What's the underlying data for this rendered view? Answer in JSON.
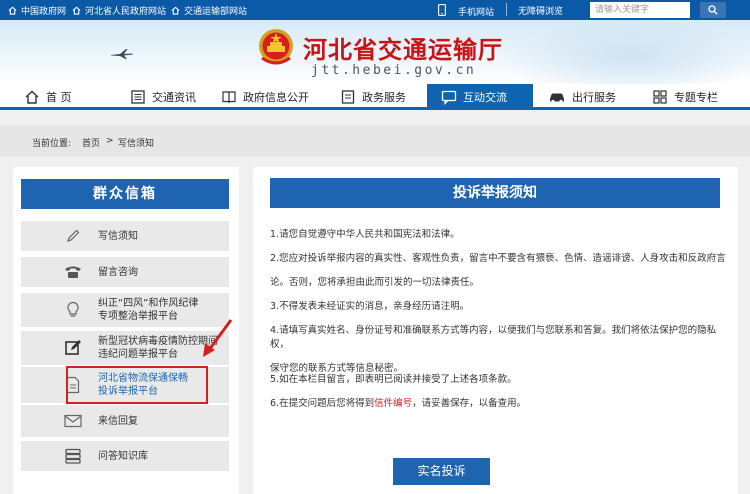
{
  "topbar": {
    "links": [
      "中国政府网",
      "河北省人民政府网站",
      "交通运输部网站"
    ],
    "mobile": "手机网站",
    "accessible": "无障碍浏览",
    "search_placeholder": "请输入关键字"
  },
  "header": {
    "title": "河北省交通运输厅",
    "domain": "jtt.hebei.gov.cn"
  },
  "nav": {
    "items": [
      {
        "label": "首  页",
        "icon": "home-icon"
      },
      {
        "label": "交通资讯",
        "icon": "news-icon"
      },
      {
        "label": "政府信息公开",
        "icon": "book-icon"
      },
      {
        "label": "政务服务",
        "icon": "form-icon"
      },
      {
        "label": "互动交流",
        "icon": "chat-icon"
      },
      {
        "label": "出行服务",
        "icon": "car-icon"
      },
      {
        "label": "专题专栏",
        "icon": "grid-icon"
      }
    ],
    "active_index": 4,
    "accent": "#0e64ae"
  },
  "breadcrumb": {
    "prefix": "当前位置:",
    "home": "首页",
    "separator": ">",
    "current": "写信须知"
  },
  "sidebar": {
    "title": "群众信箱",
    "items": [
      {
        "line1": "写信须知",
        "line2": "",
        "icon": "pen-icon"
      },
      {
        "line1": "留言咨询",
        "line2": "",
        "icon": "phone-icon"
      },
      {
        "line1": "纠正“四风”和作风纪律",
        "line2": "专项整治举报平台",
        "icon": "bulb-icon"
      },
      {
        "line1": "新型冠状病毒疫情防控期间",
        "line2": "违纪问题举报平台",
        "icon": "edit-icon"
      },
      {
        "line1": "河北省物流保通保畅",
        "line2": "投诉举报平台",
        "icon": "document-icon",
        "link_color": "#1e64b0"
      },
      {
        "line1": "来信回复",
        "line2": "",
        "icon": "mail-icon"
      },
      {
        "line1": "问答知识库",
        "line2": "",
        "icon": "database-icon"
      }
    ]
  },
  "notice": {
    "title": "投诉举报须知",
    "p1": "1.请您自觉遵守中华人民共和国宪法和法律。",
    "p2a": "2.您应对投诉举报内容的真实性、客观性负责，留言中不要含有猥亵、色情、造谣诽谤、人身攻击和反政府言",
    "p2b": "论。否则，您将承担由此而引发的一切法律责任。",
    "p3": "3.不得发表未经证实的消息，亲身经历请注明。",
    "p4a": "4.请填写真实姓名、身份证号和准确联系方式等内容，以便我们与您联系和答复。我们将依法保护您的隐私权，",
    "p4b": "保守您的联系方式等信息秘密。",
    "p5": "5.如在本栏目留言，即表明已阅读并接受了上述各项条款。",
    "p6_pre": "6.在提交问题后您将得到",
    "p6_red": "信件编号",
    "p6_post": "，请妥善保存，以备查用。",
    "button": "实名投诉"
  },
  "colors": {
    "topbar": "#0a5aa8",
    "title_red": "#c81414",
    "panel_blue": "#1e64b0",
    "highlight_red": "#d42020"
  }
}
